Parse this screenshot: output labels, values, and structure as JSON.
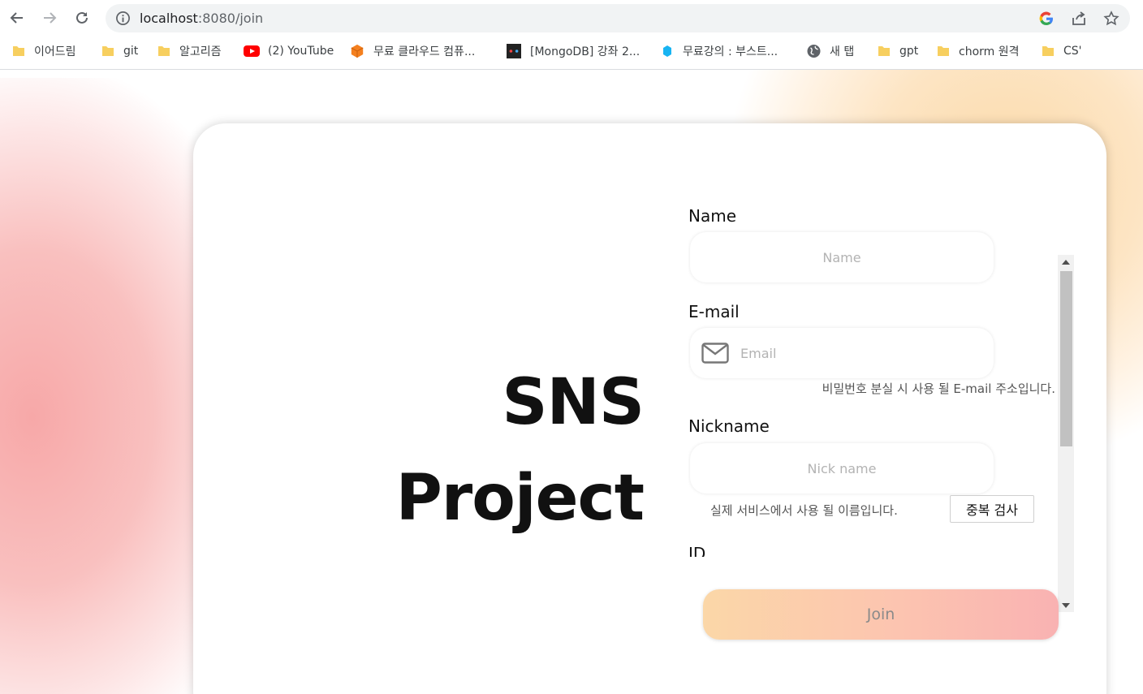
{
  "browser": {
    "url_host": "localhost",
    "url_path": ":8080/join",
    "bookmarks": [
      {
        "label": "이어드림",
        "icon": "folder-icon"
      },
      {
        "label": "git",
        "icon": "folder-icon"
      },
      {
        "label": "알고리즘",
        "icon": "folder-icon"
      },
      {
        "label": "(2) YouTube",
        "icon": "youtube-icon"
      },
      {
        "label": "무료 클라우드 컴퓨...",
        "icon": "cube-icon"
      },
      {
        "label": "[MongoDB] 강좌 2...",
        "icon": "site-icon"
      },
      {
        "label": "무료강의 : 부스트...",
        "icon": "hexagon-icon"
      },
      {
        "label": "새 탭",
        "icon": "globe-icon"
      },
      {
        "label": "gpt",
        "icon": "folder-icon"
      },
      {
        "label": "chorm 원격",
        "icon": "folder-icon"
      },
      {
        "label": "CS'",
        "icon": "folder-icon"
      }
    ]
  },
  "page": {
    "brand_line1": "SNS",
    "brand_line2": "Project",
    "form": {
      "name_label": "Name",
      "name_placeholder": "Name",
      "email_label": "E-mail",
      "email_placeholder": "Email",
      "email_hint": "비밀번호 분실 시 사용 될 E-mail 주소입니다.",
      "nickname_label": "Nickname",
      "nickname_placeholder": "Nick name",
      "nickname_hint": "실제 서비스에서 사용 될 이름입니다.",
      "duplicate_check_label": "중복 검사",
      "id_label": "ID"
    },
    "join_label": "Join",
    "colors": {
      "blob_left": "#f7a8a8",
      "blob_right": "#fbd9a8",
      "join_gradient_start": "#fbd7a8",
      "join_gradient_end": "#f9b2b2"
    }
  }
}
